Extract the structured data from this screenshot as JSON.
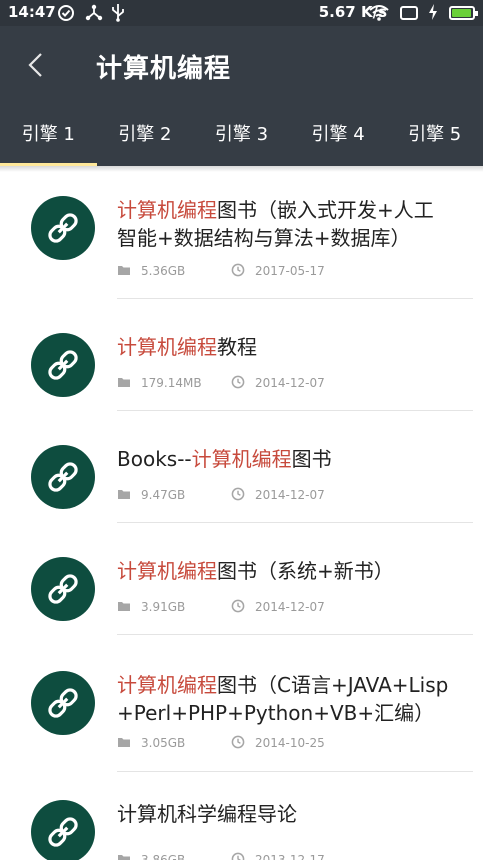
{
  "status_bar": {
    "time": "14:47",
    "speed": "5.67 K/s",
    "battery_level": 0.95,
    "colors": {
      "battery_fill": "#6ad038"
    }
  },
  "appbar": {
    "title": "计算机编程",
    "back_icon": "chevron-left-icon"
  },
  "tabs": [
    {
      "label": "引擎 1",
      "active": true
    },
    {
      "label": "引擎 2",
      "active": false
    },
    {
      "label": "引擎 3",
      "active": false
    },
    {
      "label": "引擎 4",
      "active": false
    },
    {
      "label": "引擎 5",
      "active": false
    }
  ],
  "results": [
    {
      "pre": "",
      "hl": "计算机编程",
      "post_line1": "图书（嵌入式开发+人工",
      "line2": "智能+数据结构与算法+数据库）",
      "size": "5.36GB",
      "date": "2017-05-17"
    },
    {
      "pre": "",
      "hl": "计算机编程",
      "post_line1": "教程",
      "line2": "",
      "size": "179.14MB",
      "date": "2014-12-07"
    },
    {
      "pre": "Books--",
      "hl": "计算机编程",
      "post_line1": "图书",
      "line2": "",
      "size": "9.47GB",
      "date": "2014-12-07"
    },
    {
      "pre": "",
      "hl": "计算机编程",
      "post_line1": "图书（系统+新书）",
      "line2": "",
      "size": "3.91GB",
      "date": "2014-12-07"
    },
    {
      "pre": "",
      "hl": "计算机编程",
      "post_line1": "图书（C语言+JAVA+Lisp",
      "line2": "+Perl+PHP+Python+VB+汇编）",
      "size": "3.05GB",
      "date": "2014-10-25"
    },
    {
      "pre": "计算机科学编程导论",
      "hl": "",
      "post_line1": "",
      "line2": "",
      "size": "3.86GB",
      "date": "2013-12-17"
    }
  ],
  "colors": {
    "appbar": "#363d45",
    "highlight": "#c74a3c",
    "avatar": "#0e4d3f",
    "tab_indicator": "#ffe89a"
  }
}
